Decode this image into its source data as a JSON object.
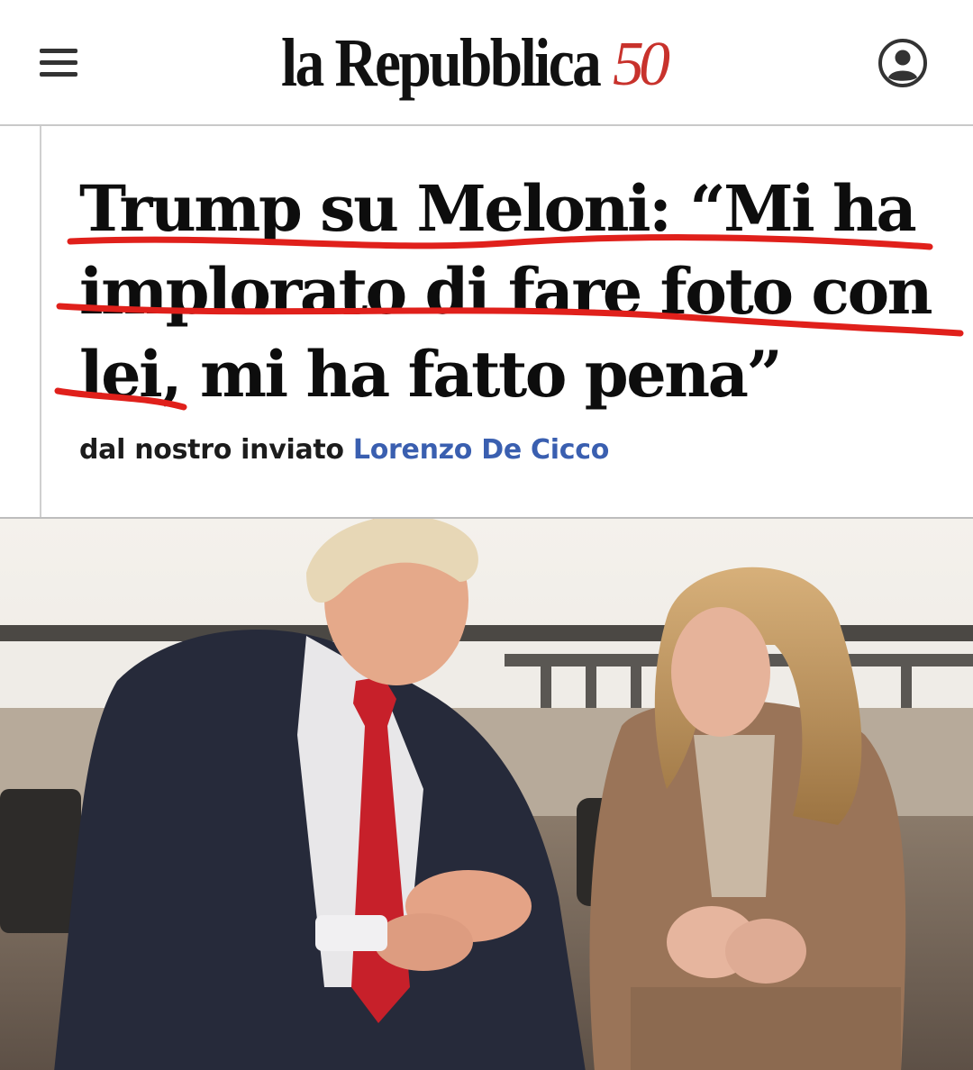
{
  "header": {
    "menu_icon": "hamburger-menu-icon",
    "logo_text": "la Repubblica",
    "logo_anniversary": "50",
    "user_icon": "user-account-icon",
    "accent_color": "#c8322c"
  },
  "article": {
    "headline_lines": [
      "Trump su Meloni: “Mi ha",
      "implorato di fare foto con",
      "lei, mi ha fatto pena”"
    ],
    "byline_prefix": "dal nostro inviato",
    "author": "Lorenzo De Cicco",
    "author_color": "#3a5fb0",
    "underline_color": "#e0201b"
  },
  "photo": {
    "subject": "two-people-seated-on-sofa"
  }
}
